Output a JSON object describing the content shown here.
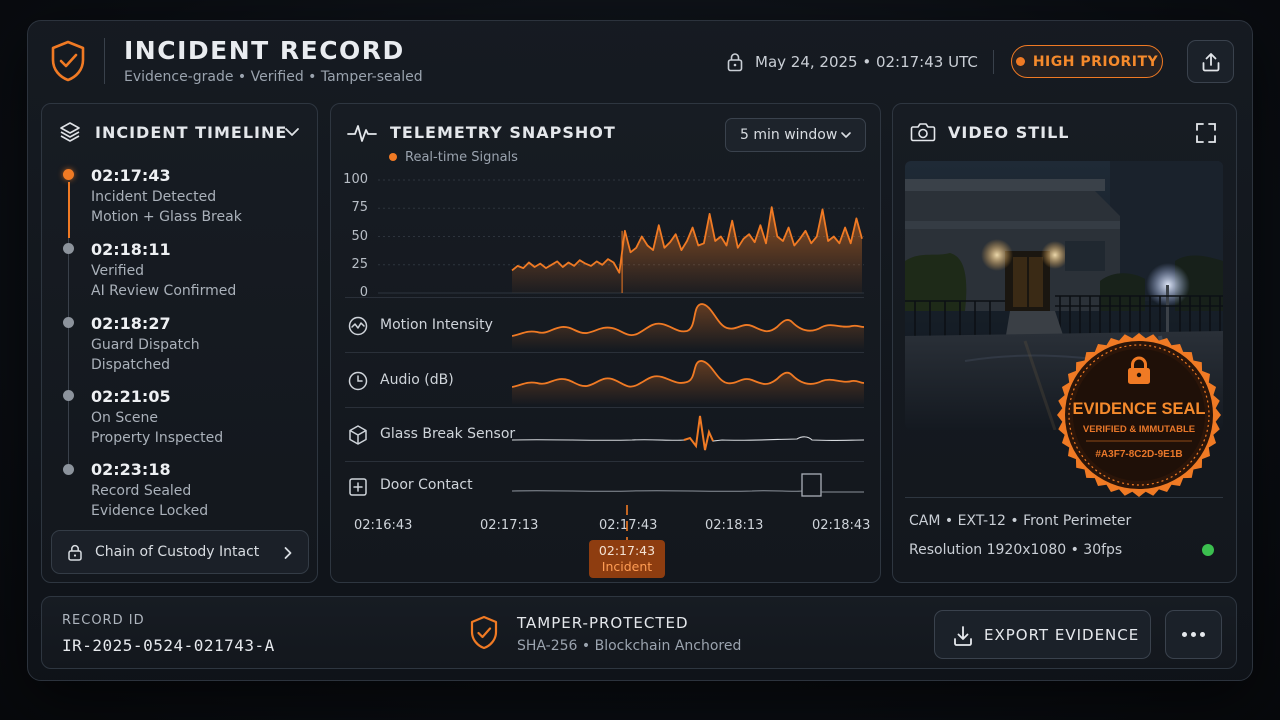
{
  "header": {
    "title": "INCIDENT RECORD",
    "subtitle": "Evidence-grade • Verified • Tamper-sealed",
    "timestamp": "May 24, 2025  •  02:17:43 UTC",
    "priority": "HIGH PRIORITY",
    "icon": "shield-check-icon",
    "accent_color": "#f07a24"
  },
  "timeline": {
    "title": "INCIDENT TIMELINE",
    "events": [
      {
        "time": "02:17:43",
        "line1": "Incident Detected",
        "line2": "Motion + Glass Break",
        "active": true
      },
      {
        "time": "02:18:11",
        "line1": "Verified",
        "line2": "AI Review Confirmed"
      },
      {
        "time": "02:18:27",
        "line1": "Guard Dispatch",
        "line2": "Dispatched"
      },
      {
        "time": "02:21:05",
        "line1": "On Scene",
        "line2": "Property Inspected"
      },
      {
        "time": "02:23:18",
        "line1": "Record Sealed",
        "line2": "Evidence Locked"
      }
    ],
    "custody_label": "Chain of Custody Intact"
  },
  "telemetry": {
    "title": "TELEMETRY SNAPSHOT",
    "subtitle": "Real-time Signals",
    "window_select": "5 min window",
    "y_ticks": [
      "100",
      "75",
      "50",
      "25",
      "0"
    ],
    "signals": [
      "Motion Intensity",
      "Audio (dB)",
      "Glass Break Sensor",
      "Door Contact"
    ],
    "x_ticks": [
      "02:16:43",
      "02:17:13",
      "02:17:43",
      "02:18:13",
      "02:18:43"
    ],
    "incident_time": "02:17:43",
    "incident_label": "Incident"
  },
  "chart_data": {
    "type": "area",
    "x_start": "02:16:43",
    "x_end": "02:18:43",
    "ylim": [
      0,
      100
    ],
    "grid": true,
    "series": [
      {
        "values": [
          20,
          24,
          22,
          27,
          23,
          26,
          22,
          25,
          28,
          23,
          27,
          24,
          29,
          26,
          24,
          28,
          25,
          30,
          27,
          18,
          55,
          36,
          40,
          50,
          42,
          38,
          60,
          40,
          45,
          52,
          38,
          46,
          58,
          42,
          44,
          70,
          46,
          50,
          42,
          64,
          40,
          48,
          52,
          45,
          60,
          44,
          76,
          50,
          46,
          58,
          42,
          48,
          55,
          44,
          50,
          74,
          46,
          50,
          44,
          58,
          44,
          66,
          48
        ]
      }
    ]
  },
  "video": {
    "title": "VIDEO STILL",
    "seal_title": "EVIDENCE SEAL",
    "seal_sub": "VERIFIED & IMMUTABLE",
    "seal_hash": "#A3F7-8C2D-9E1B",
    "cam_info": "CAM  •  EXT-12  •  Front Perimeter",
    "resolution": "Resolution 1920x1080  •  30fps",
    "status_color": "#3bbf4f"
  },
  "footer": {
    "record_label": "RECORD ID",
    "record_id": "IR-2025-0524-021743-A",
    "tamper_title": "TAMPER-PROTECTED",
    "tamper_sub": "SHA-256  •  Blockchain Anchored",
    "export_label": "EXPORT EVIDENCE"
  }
}
